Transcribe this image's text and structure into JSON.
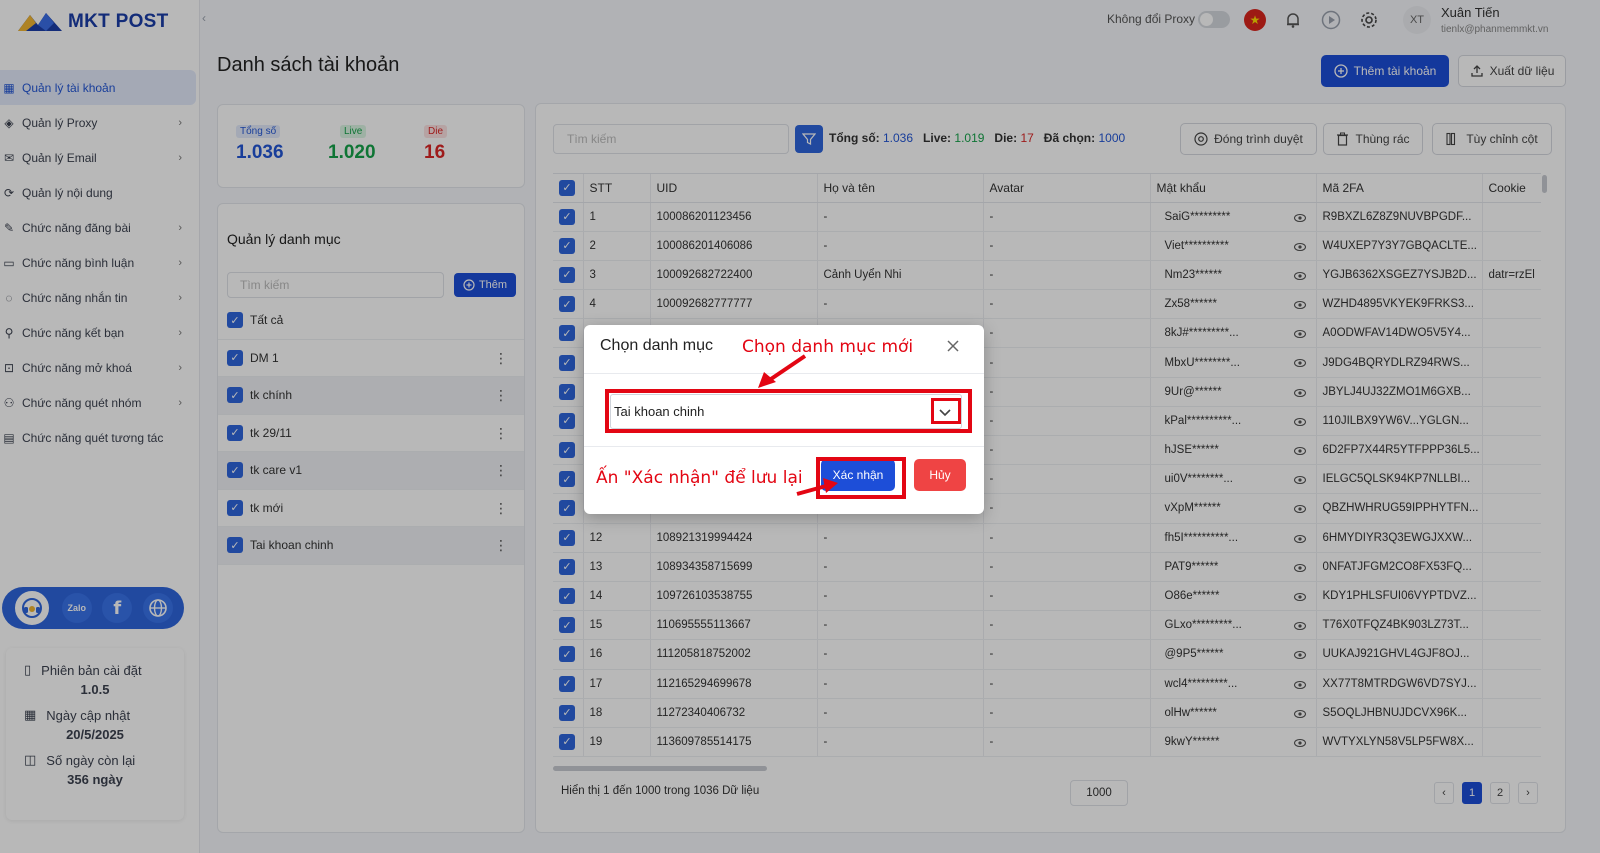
{
  "brand": {
    "name": "MKT POST"
  },
  "sidebar": {
    "items": [
      {
        "label": "Quản lý tài khoản",
        "icon": "grid-icon",
        "active": true,
        "has_children": false
      },
      {
        "label": "Quản lý Proxy",
        "icon": "layers-icon",
        "active": false,
        "has_children": true
      },
      {
        "label": "Quản lý Email",
        "icon": "mail-icon",
        "active": false,
        "has_children": true
      },
      {
        "label": "Quản lý nội dung",
        "icon": "content-icon",
        "active": false,
        "has_children": false
      },
      {
        "label": "Chức năng đăng bài",
        "icon": "post-icon",
        "active": false,
        "has_children": true
      },
      {
        "label": "Chức năng bình luận",
        "icon": "comment-icon",
        "active": false,
        "has_children": true
      },
      {
        "label": "Chức năng nhắn tin",
        "icon": "message-icon",
        "active": false,
        "has_children": true
      },
      {
        "label": "Chức năng kết bạn",
        "icon": "add-friend-icon",
        "active": false,
        "has_children": true
      },
      {
        "label": "Chức năng mở khoá",
        "icon": "unlock-icon",
        "active": false,
        "has_children": true
      },
      {
        "label": "Chức năng quét nhóm",
        "icon": "group-icon",
        "active": false,
        "has_children": true
      },
      {
        "label": "Chức năng quét tương tác",
        "icon": "interaction-icon",
        "active": false,
        "has_children": false
      }
    ],
    "social": [
      "support-icon",
      "zalo-icon",
      "facebook-icon",
      "website-icon"
    ],
    "zalo_label": "Zalo",
    "version": {
      "install_label": "Phiên bản cài đặt",
      "install_value": "1.0.5",
      "update_label": "Ngày cập nhật",
      "update_value": "20/5/2025",
      "remaining_label": "Số ngày còn lại",
      "remaining_value": "356 ngày"
    }
  },
  "header": {
    "proxy_label": "Không đổi Proxy",
    "proxy_enabled": false,
    "avatar_initials": "XT",
    "user_name": "Xuân Tiến",
    "user_email": "tienlx@phanmemmkt.vn"
  },
  "page": {
    "title": "Danh sách tài khoản",
    "add_account": "Thêm tài khoản",
    "export": "Xuất dữ liệu"
  },
  "stats": {
    "total_label": "Tổng số",
    "total": "1.036",
    "live_label": "Live",
    "live": "1.020",
    "die_label": "Die",
    "die": "16"
  },
  "categories": {
    "title": "Quản lý danh mục",
    "search_placeholder": "Tìm kiếm",
    "add_label": "Thêm",
    "items": [
      "Tất cả",
      "DM 1",
      "tk chính",
      "tk 29/11",
      "tk care v1",
      "tk mới",
      "Tai khoan chinh"
    ]
  },
  "table_toolbar": {
    "search_placeholder": "Tìm kiếm",
    "total_label": "Tổng số:",
    "total": "1.036",
    "live_label": "Live:",
    "live": "1.019",
    "die_label": "Die:",
    "die": "17",
    "selected_label": "Đã chọn:",
    "selected": "1000",
    "close_browser": "Đóng trình duyệt",
    "trash": "Thùng rác",
    "columns": "Tùy chỉnh cột"
  },
  "table": {
    "columns": [
      "STT",
      "UID",
      "Họ và tên",
      "Avatar",
      "Mật khẩu",
      "Mã 2FA",
      "Cookie"
    ],
    "rows": [
      [
        "1",
        "100086201123456",
        "-",
        "-",
        "SaiG*********",
        "R9BXZL6Z8Z9NUVBPGDF...",
        ""
      ],
      [
        "2",
        "100086201406086",
        "-",
        "-",
        "Viet**********",
        "W4UXEP7Y3Y7GBQACLTE...",
        ""
      ],
      [
        "3",
        "100092682722400",
        "Cảnh Uyển Nhi",
        "-",
        "Nm23******",
        "YGJB6362XSGEZ7YSJB2D...",
        "datr=rzEl"
      ],
      [
        "4",
        "100092682777777",
        "-",
        "-",
        "Zx58******",
        "WZHD4895VKYEK9FRKS3...",
        ""
      ],
      [
        "",
        "",
        "",
        "-",
        "8kJ#*********...",
        "A0ODWFAV14DWO5V5Y4...",
        ""
      ],
      [
        "",
        "",
        "",
        "-",
        "MbxU********...",
        "J9DG4BQRYDLRZ94RWS...",
        ""
      ],
      [
        "",
        "",
        "",
        "-",
        "9Ur@******",
        "JBYLJ4UJ32ZMO1M6GXB...",
        ""
      ],
      [
        "",
        "",
        "",
        "-",
        "kPal**********...",
        "110JILBX9YW6V...YGLGN...",
        ""
      ],
      [
        "",
        "",
        "",
        "-",
        "hJSE******",
        "6D2FP7X44R5YTFPPP36L5...",
        ""
      ],
      [
        "",
        "",
        "",
        "-",
        "ui0V********...",
        "IELGC5QLSK94KP7NLLBI...",
        ""
      ],
      [
        "",
        "",
        "",
        "-",
        "vXpM******",
        "QBZHWHRUG59IPPHYTFN...",
        ""
      ],
      [
        "12",
        "108921319994424",
        "-",
        "-",
        "fh5I**********...",
        "6HMYDIYR3Q3EWGJXXW...",
        ""
      ],
      [
        "13",
        "108934358715699",
        "-",
        "-",
        "PAT9******",
        "0NFATJFGM2CO8FX53FQ...",
        ""
      ],
      [
        "14",
        "109726103538755",
        "-",
        "-",
        "O86e******",
        "KDY1PHLSFUI06VYPTDVZ...",
        ""
      ],
      [
        "15",
        "110695555113667",
        "-",
        "-",
        "GLxo*********...",
        "T76X0TFQZ4BK903LZ73T...",
        ""
      ],
      [
        "16",
        "111205818752002",
        "-",
        "-",
        "@9P5******",
        "UUKAJ921GHVL4GJF8OJ...",
        ""
      ],
      [
        "17",
        "112165294699678",
        "-",
        "-",
        "wcl4*********...",
        "XX77T8MTRDGW6VD7SYJ...",
        ""
      ],
      [
        "18",
        "11272340406732",
        "-",
        "-",
        "olHw******",
        "S5OQLJHBNUJDCVX96K...",
        ""
      ],
      [
        "19",
        "113609785514175",
        "-",
        "-",
        "9kwY******",
        "WVTYXLYN58V5LP5FW8X...",
        ""
      ]
    ]
  },
  "footer": {
    "info": "Hiển thị 1 đến 1000 trong 1036 Dữ liệu",
    "page_size": "1000",
    "pages": [
      "1",
      "2"
    ],
    "current_page": "1",
    "prev": "‹",
    "next": "›"
  },
  "modal": {
    "title": "Chọn danh mục",
    "selected_value": "Tai khoan chinh",
    "confirm": "Xác nhận",
    "cancel": "Hủy"
  },
  "annotations": {
    "select_hint": "Chọn danh mục mới",
    "confirm_hint": "Ấn \"Xác nhận\" để lưu lại"
  },
  "colors": {
    "primary": "#1d4ed8",
    "checkbox": "#2f66dd",
    "live": "#16a34a",
    "die": "#dc2626",
    "annotation": "#e30613"
  }
}
